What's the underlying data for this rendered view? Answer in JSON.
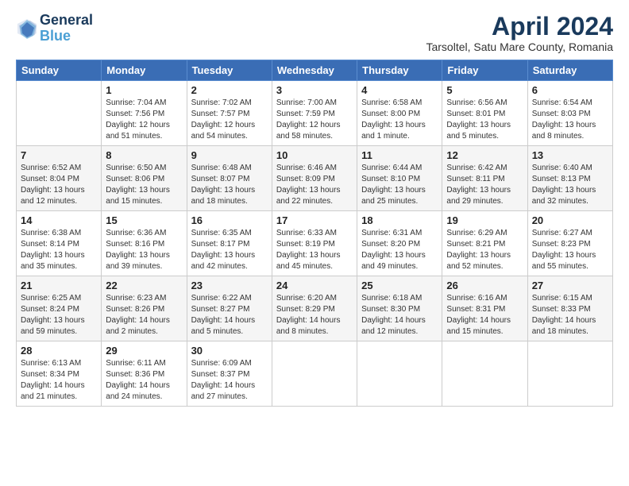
{
  "header": {
    "logo_line1": "General",
    "logo_line2": "Blue",
    "title": "April 2024",
    "subtitle": "Tarsoltel, Satu Mare County, Romania"
  },
  "columns": [
    "Sunday",
    "Monday",
    "Tuesday",
    "Wednesday",
    "Thursday",
    "Friday",
    "Saturday"
  ],
  "weeks": [
    [
      {
        "day": "",
        "content": ""
      },
      {
        "day": "1",
        "content": "Sunrise: 7:04 AM\nSunset: 7:56 PM\nDaylight: 12 hours\nand 51 minutes."
      },
      {
        "day": "2",
        "content": "Sunrise: 7:02 AM\nSunset: 7:57 PM\nDaylight: 12 hours\nand 54 minutes."
      },
      {
        "day": "3",
        "content": "Sunrise: 7:00 AM\nSunset: 7:59 PM\nDaylight: 12 hours\nand 58 minutes."
      },
      {
        "day": "4",
        "content": "Sunrise: 6:58 AM\nSunset: 8:00 PM\nDaylight: 13 hours\nand 1 minute."
      },
      {
        "day": "5",
        "content": "Sunrise: 6:56 AM\nSunset: 8:01 PM\nDaylight: 13 hours\nand 5 minutes."
      },
      {
        "day": "6",
        "content": "Sunrise: 6:54 AM\nSunset: 8:03 PM\nDaylight: 13 hours\nand 8 minutes."
      }
    ],
    [
      {
        "day": "7",
        "content": "Sunrise: 6:52 AM\nSunset: 8:04 PM\nDaylight: 13 hours\nand 12 minutes."
      },
      {
        "day": "8",
        "content": "Sunrise: 6:50 AM\nSunset: 8:06 PM\nDaylight: 13 hours\nand 15 minutes."
      },
      {
        "day": "9",
        "content": "Sunrise: 6:48 AM\nSunset: 8:07 PM\nDaylight: 13 hours\nand 18 minutes."
      },
      {
        "day": "10",
        "content": "Sunrise: 6:46 AM\nSunset: 8:09 PM\nDaylight: 13 hours\nand 22 minutes."
      },
      {
        "day": "11",
        "content": "Sunrise: 6:44 AM\nSunset: 8:10 PM\nDaylight: 13 hours\nand 25 minutes."
      },
      {
        "day": "12",
        "content": "Sunrise: 6:42 AM\nSunset: 8:11 PM\nDaylight: 13 hours\nand 29 minutes."
      },
      {
        "day": "13",
        "content": "Sunrise: 6:40 AM\nSunset: 8:13 PM\nDaylight: 13 hours\nand 32 minutes."
      }
    ],
    [
      {
        "day": "14",
        "content": "Sunrise: 6:38 AM\nSunset: 8:14 PM\nDaylight: 13 hours\nand 35 minutes."
      },
      {
        "day": "15",
        "content": "Sunrise: 6:36 AM\nSunset: 8:16 PM\nDaylight: 13 hours\nand 39 minutes."
      },
      {
        "day": "16",
        "content": "Sunrise: 6:35 AM\nSunset: 8:17 PM\nDaylight: 13 hours\nand 42 minutes."
      },
      {
        "day": "17",
        "content": "Sunrise: 6:33 AM\nSunset: 8:19 PM\nDaylight: 13 hours\nand 45 minutes."
      },
      {
        "day": "18",
        "content": "Sunrise: 6:31 AM\nSunset: 8:20 PM\nDaylight: 13 hours\nand 49 minutes."
      },
      {
        "day": "19",
        "content": "Sunrise: 6:29 AM\nSunset: 8:21 PM\nDaylight: 13 hours\nand 52 minutes."
      },
      {
        "day": "20",
        "content": "Sunrise: 6:27 AM\nSunset: 8:23 PM\nDaylight: 13 hours\nand 55 minutes."
      }
    ],
    [
      {
        "day": "21",
        "content": "Sunrise: 6:25 AM\nSunset: 8:24 PM\nDaylight: 13 hours\nand 59 minutes."
      },
      {
        "day": "22",
        "content": "Sunrise: 6:23 AM\nSunset: 8:26 PM\nDaylight: 14 hours\nand 2 minutes."
      },
      {
        "day": "23",
        "content": "Sunrise: 6:22 AM\nSunset: 8:27 PM\nDaylight: 14 hours\nand 5 minutes."
      },
      {
        "day": "24",
        "content": "Sunrise: 6:20 AM\nSunset: 8:29 PM\nDaylight: 14 hours\nand 8 minutes."
      },
      {
        "day": "25",
        "content": "Sunrise: 6:18 AM\nSunset: 8:30 PM\nDaylight: 14 hours\nand 12 minutes."
      },
      {
        "day": "26",
        "content": "Sunrise: 6:16 AM\nSunset: 8:31 PM\nDaylight: 14 hours\nand 15 minutes."
      },
      {
        "day": "27",
        "content": "Sunrise: 6:15 AM\nSunset: 8:33 PM\nDaylight: 14 hours\nand 18 minutes."
      }
    ],
    [
      {
        "day": "28",
        "content": "Sunrise: 6:13 AM\nSunset: 8:34 PM\nDaylight: 14 hours\nand 21 minutes."
      },
      {
        "day": "29",
        "content": "Sunrise: 6:11 AM\nSunset: 8:36 PM\nDaylight: 14 hours\nand 24 minutes."
      },
      {
        "day": "30",
        "content": "Sunrise: 6:09 AM\nSunset: 8:37 PM\nDaylight: 14 hours\nand 27 minutes."
      },
      {
        "day": "",
        "content": ""
      },
      {
        "day": "",
        "content": ""
      },
      {
        "day": "",
        "content": ""
      },
      {
        "day": "",
        "content": ""
      }
    ]
  ]
}
